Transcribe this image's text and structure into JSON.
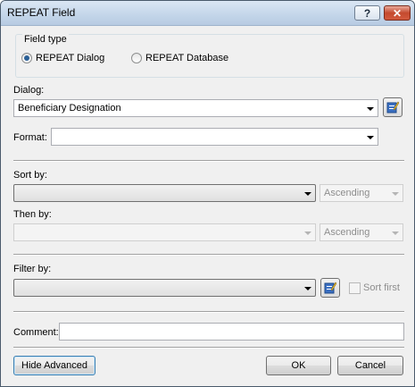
{
  "window": {
    "title": "REPEAT Field",
    "help_label": "?",
    "close_label": "✕"
  },
  "field_type": {
    "label": "Field type",
    "options": [
      {
        "label": "REPEAT Dialog",
        "checked": true
      },
      {
        "label": "REPEAT Database",
        "checked": false
      }
    ]
  },
  "dialog": {
    "label": "Dialog:",
    "value": "Beneficiary Designation"
  },
  "format": {
    "label": "Format:",
    "value": ""
  },
  "sort_by": {
    "label": "Sort by:",
    "value": "",
    "order": "Ascending"
  },
  "then_by": {
    "label": "Then by:",
    "value": "",
    "order": "Ascending"
  },
  "filter_by": {
    "label": "Filter by:",
    "value": "",
    "sort_first_label": "Sort first"
  },
  "comment": {
    "label": "Comment:",
    "value": ""
  },
  "buttons": {
    "hide_advanced": "Hide Advanced",
    "ok": "OK",
    "cancel": "Cancel"
  },
  "icons": {
    "edit": "edit-pencil-icon",
    "help": "help-icon",
    "close": "close-icon"
  },
  "colors": {
    "title_bar": "#c3d5e9",
    "close_button": "#c44a2e",
    "focus_border": "#3c7fb1"
  }
}
